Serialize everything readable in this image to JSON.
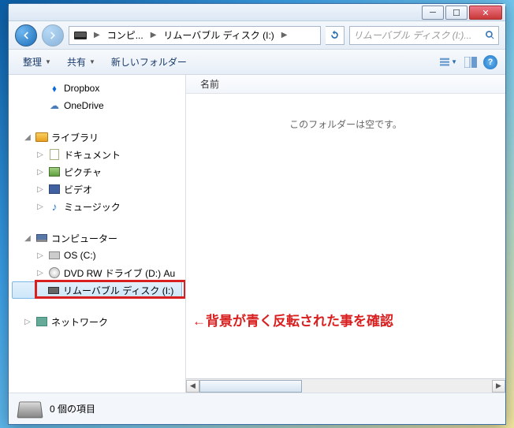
{
  "breadcrumb": {
    "seg1": "コンピ...",
    "seg2": "リムーバブル ディスク (I:)"
  },
  "search": {
    "placeholder": "リムーバブル ディスク (I:)..."
  },
  "toolbar": {
    "organize": "整理",
    "share": "共有",
    "newfolder": "新しいフォルダー"
  },
  "tree": {
    "dropbox": "Dropbox",
    "onedrive": "OneDrive",
    "libraries": "ライブラリ",
    "documents": "ドキュメント",
    "pictures": "ピクチャ",
    "videos": "ビデオ",
    "music": "ミュージック",
    "computer": "コンピューター",
    "os": "OS (C:)",
    "dvd": "DVD RW ドライブ (D:) Au",
    "removable": "リムーバブル ディスク (I:)",
    "network": "ネットワーク"
  },
  "content": {
    "column_name": "名前",
    "empty_msg": "このフォルダーは空です。"
  },
  "status": {
    "items": "0 個の項目"
  },
  "annotation": {
    "text": "←背景が青く反転された事を確認"
  }
}
